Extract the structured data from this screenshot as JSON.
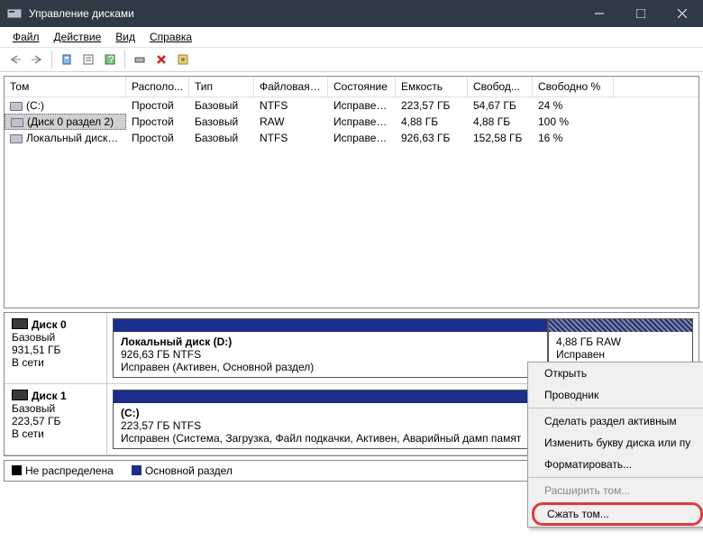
{
  "title": "Управление дисками",
  "menu": {
    "file": "Файл",
    "action": "Действие",
    "view": "Вид",
    "help": "Справка"
  },
  "columns": [
    "Том",
    "Располо...",
    "Тип",
    "Файловая с...",
    "Состояние",
    "Емкость",
    "Свобод...",
    "Свободно %"
  ],
  "rows": [
    {
      "name": "(C:)",
      "layout": "Простой",
      "type": "Базовый",
      "fs": "NTFS",
      "status": "Исправен...",
      "cap": "223,57 ГБ",
      "free": "54,67 ГБ",
      "pct": "24 %"
    },
    {
      "name": "(Диск 0 раздел 2)",
      "layout": "Простой",
      "type": "Базовый",
      "fs": "RAW",
      "status": "Исправен...",
      "cap": "4,88 ГБ",
      "free": "4,88 ГБ",
      "pct": "100 %",
      "sel": true
    },
    {
      "name": "Локальный диск (...",
      "layout": "Простой",
      "type": "Базовый",
      "fs": "NTFS",
      "status": "Исправен...",
      "cap": "926,63 ГБ",
      "free": "152,58 ГБ",
      "pct": "16 %"
    }
  ],
  "disks": [
    {
      "name": "Диск 0",
      "type": "Базовый",
      "size": "931,51 ГБ",
      "online": "В сети",
      "parts": [
        {
          "title": "Локальный диск  (D:)",
          "sub": "926,63 ГБ NTFS",
          "stat": "Исправен (Активен, Основной раздел)",
          "w": "75%",
          "hatch": false
        },
        {
          "title": "",
          "sub": "4,88 ГБ RAW",
          "stat": "Исправен",
          "w": "25%",
          "hatch": true
        }
      ]
    },
    {
      "name": "Диск 1",
      "type": "Базовый",
      "size": "223,57 ГБ",
      "online": "В сети",
      "parts": [
        {
          "title": "(C:)",
          "sub": "223,57 ГБ NTFS",
          "stat": "Исправен (Система, Загрузка, Файл подкачки, Активен, Аварийный дамп памят",
          "w": "100%",
          "hatch": false
        }
      ]
    }
  ],
  "legend": {
    "unalloc": "Не распределена",
    "primary": "Основной раздел"
  },
  "ctx": {
    "open": "Открыть",
    "explorer": "Проводник",
    "active": "Сделать раздел активным",
    "letter": "Изменить букву диска или пу",
    "format": "Форматировать...",
    "extend": "Расширить том...",
    "shrink": "Сжать том..."
  }
}
